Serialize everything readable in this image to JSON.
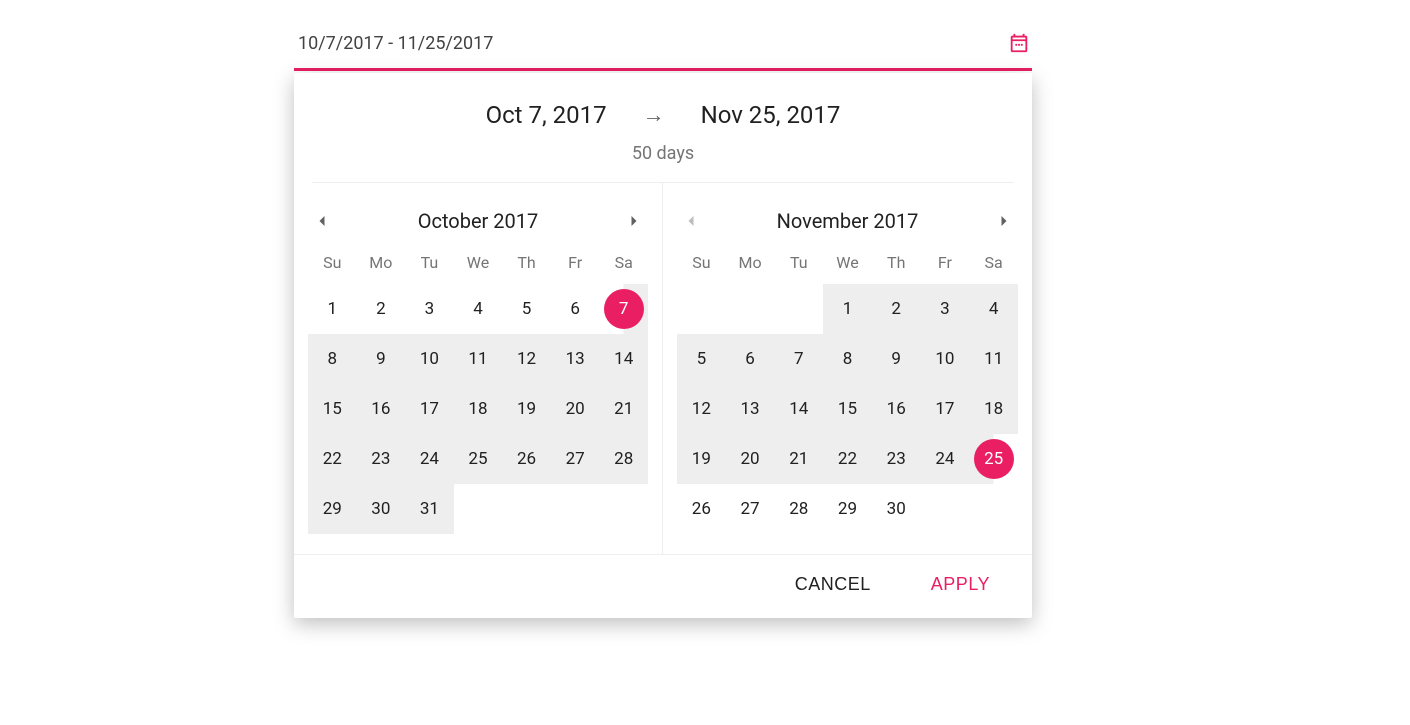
{
  "accent": "#e91e63",
  "field": {
    "value": "10/7/2017 - 11/25/2017"
  },
  "header": {
    "start": "Oct 7, 2017",
    "end": "Nov 25, 2017",
    "duration": "50 days"
  },
  "dow": [
    "Su",
    "Mo",
    "Tu",
    "We",
    "Th",
    "Fr",
    "Sa"
  ],
  "months": [
    {
      "title": "October 2017",
      "prev_enabled": true,
      "next_enabled": true,
      "lead_blanks": 0,
      "days": [
        {
          "n": 1
        },
        {
          "n": 2
        },
        {
          "n": 3
        },
        {
          "n": 4
        },
        {
          "n": 5
        },
        {
          "n": 6
        },
        {
          "n": 7,
          "selected": true,
          "edge": "start"
        },
        {
          "n": 8,
          "in": true
        },
        {
          "n": 9,
          "in": true
        },
        {
          "n": 10,
          "in": true
        },
        {
          "n": 11,
          "in": true
        },
        {
          "n": 12,
          "in": true
        },
        {
          "n": 13,
          "in": true
        },
        {
          "n": 14,
          "in": true
        },
        {
          "n": 15,
          "in": true
        },
        {
          "n": 16,
          "in": true
        },
        {
          "n": 17,
          "in": true
        },
        {
          "n": 18,
          "in": true
        },
        {
          "n": 19,
          "in": true
        },
        {
          "n": 20,
          "in": true
        },
        {
          "n": 21,
          "in": true
        },
        {
          "n": 22,
          "in": true
        },
        {
          "n": 23,
          "in": true
        },
        {
          "n": 24,
          "in": true
        },
        {
          "n": 25,
          "in": true
        },
        {
          "n": 26,
          "in": true
        },
        {
          "n": 27,
          "in": true
        },
        {
          "n": 28,
          "in": true
        },
        {
          "n": 29,
          "in": true
        },
        {
          "n": 30,
          "in": true
        },
        {
          "n": 31,
          "in": true
        }
      ]
    },
    {
      "title": "November 2017",
      "prev_enabled": false,
      "next_enabled": true,
      "lead_blanks": 3,
      "days": [
        {
          "n": 1,
          "in": true
        },
        {
          "n": 2,
          "in": true
        },
        {
          "n": 3,
          "in": true
        },
        {
          "n": 4,
          "in": true
        },
        {
          "n": 5,
          "in": true
        },
        {
          "n": 6,
          "in": true
        },
        {
          "n": 7,
          "in": true
        },
        {
          "n": 8,
          "in": true
        },
        {
          "n": 9,
          "in": true
        },
        {
          "n": 10,
          "in": true
        },
        {
          "n": 11,
          "in": true
        },
        {
          "n": 12,
          "in": true
        },
        {
          "n": 13,
          "in": true
        },
        {
          "n": 14,
          "in": true
        },
        {
          "n": 15,
          "in": true
        },
        {
          "n": 16,
          "in": true
        },
        {
          "n": 17,
          "in": true
        },
        {
          "n": 18,
          "in": true
        },
        {
          "n": 19,
          "in": true
        },
        {
          "n": 20,
          "in": true
        },
        {
          "n": 21,
          "in": true
        },
        {
          "n": 22,
          "in": true
        },
        {
          "n": 23,
          "in": true
        },
        {
          "n": 24,
          "in": true
        },
        {
          "n": 25,
          "selected": true,
          "edge": "end"
        },
        {
          "n": 26
        },
        {
          "n": 27
        },
        {
          "n": 28
        },
        {
          "n": 29
        },
        {
          "n": 30
        }
      ]
    }
  ],
  "actions": {
    "cancel": "CANCEL",
    "apply": "APPLY"
  }
}
